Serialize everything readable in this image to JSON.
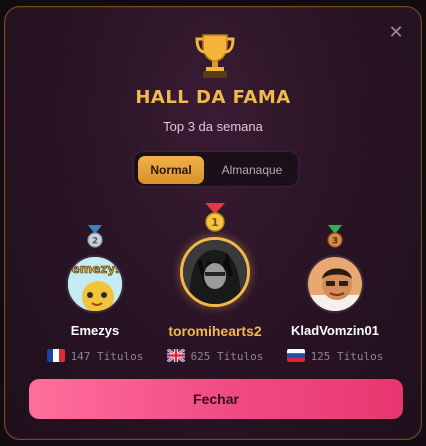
{
  "modal": {
    "title": "HALL DA FAMA",
    "subtitle": "Top 3 da semana",
    "close_label": "✕",
    "tabs": [
      {
        "label": "Normal",
        "active": true
      },
      {
        "label": "Almanaque",
        "active": false
      }
    ],
    "players": [
      {
        "rank": "2",
        "name": "Emezys",
        "country": "France",
        "titles": "147 Títulos",
        "medal_color": "#9fb3c8"
      },
      {
        "rank": "1",
        "name": "toromihearts2",
        "country": "United Kingdom",
        "titles": "625 Títulos",
        "medal_color": "#f2b84a"
      },
      {
        "rank": "3",
        "name": "KladVomzin01",
        "country": "Russia",
        "titles": "125 Títulos",
        "medal_color": "#cd7a3a"
      }
    ],
    "close_button_label": "Fechar"
  },
  "colors": {
    "accent_gold": "#f2b84a",
    "button_pink": "#f24d86",
    "background": "#2a1426"
  }
}
